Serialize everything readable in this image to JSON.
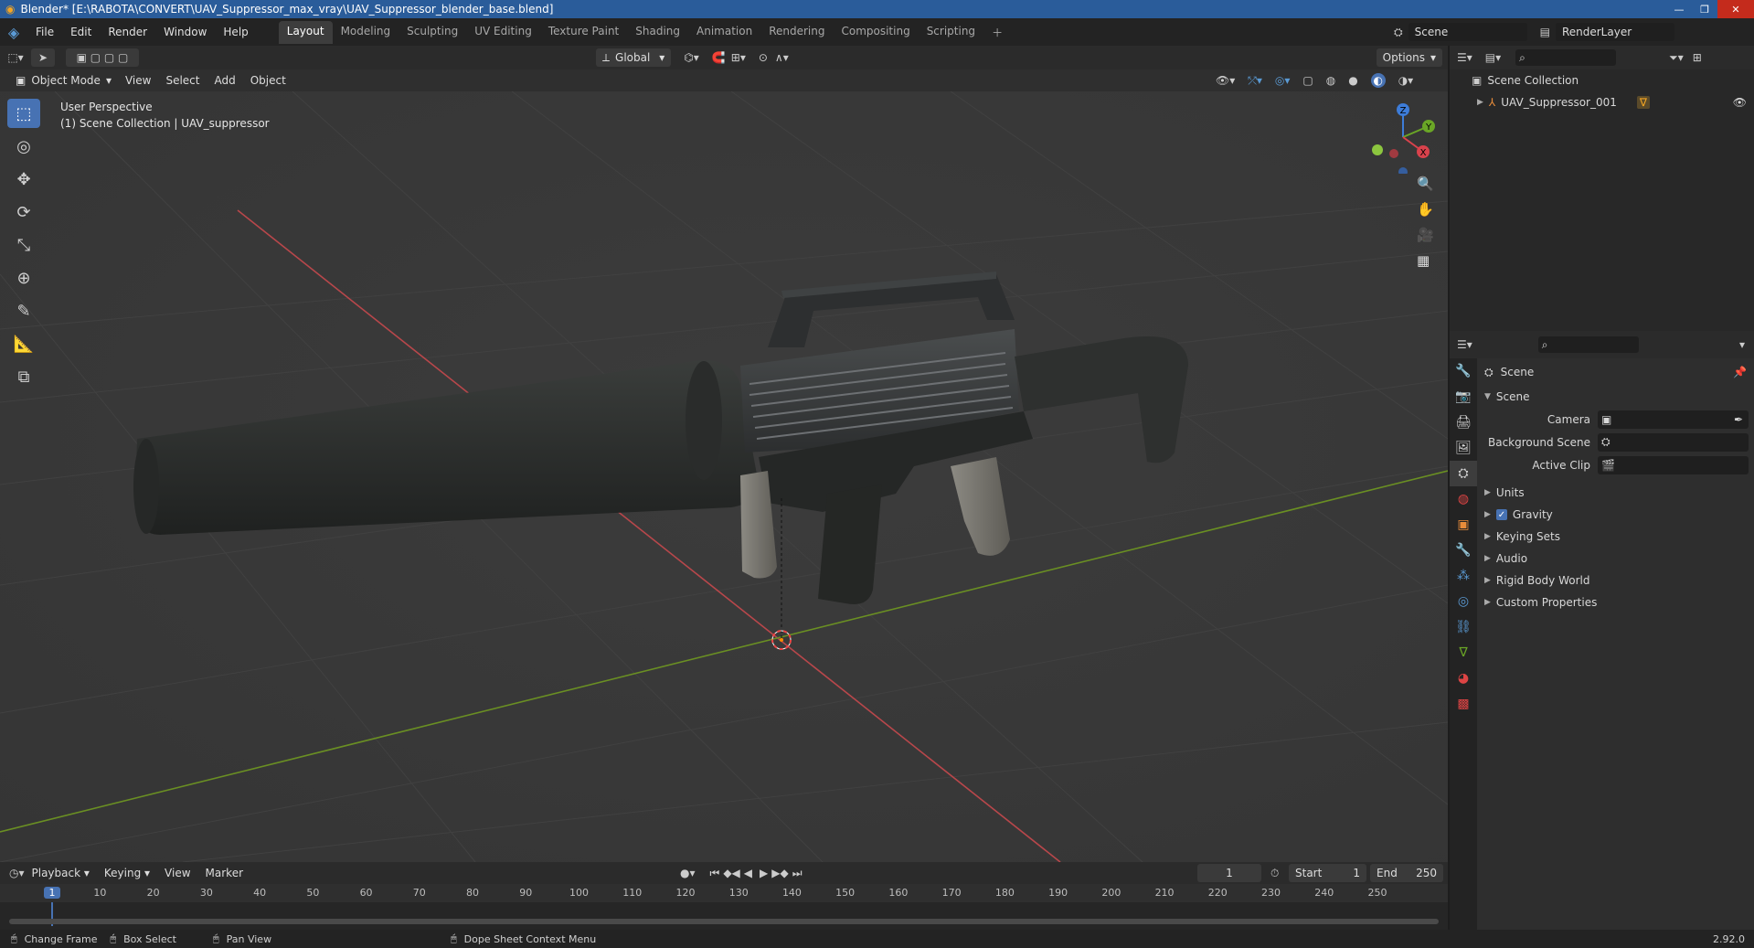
{
  "window": {
    "title": "Blender* [E:\\RABOTA\\CONVERT\\UAV_Suppressor_max_vray\\UAV_Suppressor_blender_base.blend]"
  },
  "menu": [
    "File",
    "Edit",
    "Render",
    "Window",
    "Help"
  ],
  "workspaces": [
    "Layout",
    "Modeling",
    "Sculpting",
    "UV Editing",
    "Texture Paint",
    "Shading",
    "Animation",
    "Rendering",
    "Compositing",
    "Scripting"
  ],
  "active_workspace": "Layout",
  "scene_name": "Scene",
  "render_layer": "RenderLayer",
  "tool_header": {
    "orientation": "Global",
    "options": "Options"
  },
  "viewport_header": {
    "mode": "Object Mode",
    "menus": [
      "View",
      "Select",
      "Add",
      "Object"
    ]
  },
  "viewport": {
    "perspective": "User Perspective",
    "context": "(1) Scene Collection | UAV_suppressor",
    "gizmo": {
      "z": "Z",
      "y": "Y",
      "x": "X"
    }
  },
  "outliner": {
    "collection": "Scene Collection",
    "object": "UAV_Suppressor_001"
  },
  "properties": {
    "title": "Scene",
    "panel": "Scene",
    "fields": [
      {
        "label": "Camera",
        "value": ""
      },
      {
        "label": "Background Scene",
        "value": ""
      },
      {
        "label": "Active Clip",
        "value": ""
      }
    ],
    "sections": [
      {
        "label": "Units",
        "checkbox": false
      },
      {
        "label": "Gravity",
        "checkbox": true
      },
      {
        "label": "Keying Sets",
        "checkbox": false
      },
      {
        "label": "Audio",
        "checkbox": false
      },
      {
        "label": "Rigid Body World",
        "checkbox": false
      },
      {
        "label": "Custom Properties",
        "checkbox": false
      }
    ]
  },
  "timeline": {
    "menus": [
      "Playback",
      "Keying",
      "View",
      "Marker"
    ],
    "current_frame": "1",
    "start_label": "Start",
    "start": "1",
    "end_label": "End",
    "end": "250",
    "ticks": [
      "1",
      "10",
      "20",
      "30",
      "40",
      "50",
      "60",
      "70",
      "80",
      "90",
      "100",
      "110",
      "120",
      "130",
      "140",
      "150",
      "160",
      "170",
      "180",
      "190",
      "200",
      "210",
      "220",
      "230",
      "240",
      "250"
    ]
  },
  "status": {
    "items": [
      "Change Frame",
      "Box Select",
      "Pan View",
      "Dope Sheet Context Menu"
    ],
    "version": "2.92.0"
  },
  "colors": {
    "accent": "#4772b3",
    "x_axis": "#d9424c",
    "y_axis": "#6aa626",
    "z_axis": "#3d7cd8"
  }
}
